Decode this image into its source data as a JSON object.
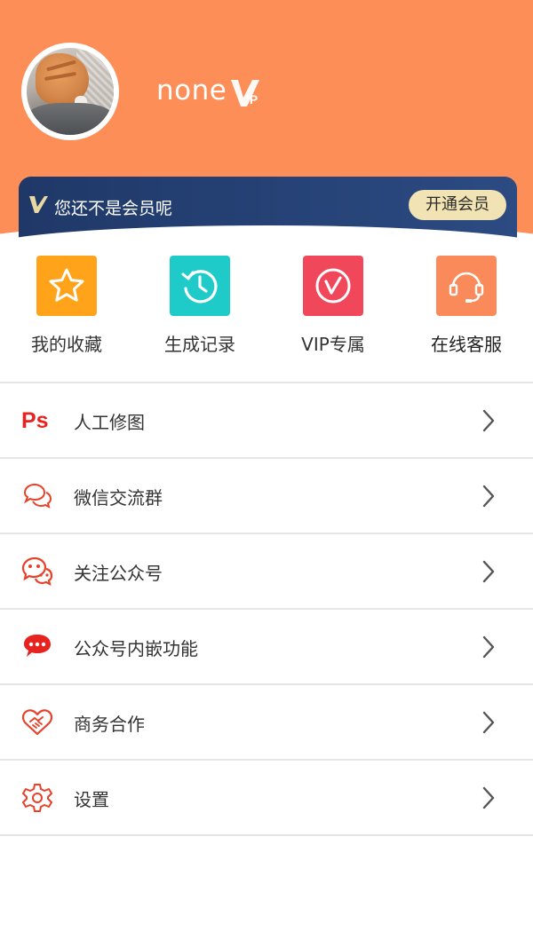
{
  "profile": {
    "username": "none",
    "vip_badge": {
      "text": "VIP",
      "icon": "vip-badge-icon"
    },
    "avatar": {
      "alt": "cat-avatar"
    }
  },
  "membership": {
    "status_text": "您还不是会员呢",
    "button_label": "开通会员",
    "icon": "vip-v-icon"
  },
  "quick_actions": [
    {
      "label": "我的收藏",
      "icon": "star-icon",
      "color": "#ffa31a"
    },
    {
      "label": "生成记录",
      "icon": "history-clock-icon",
      "color": "#1fcbc9"
    },
    {
      "label": "VIP专属",
      "icon": "vip-play-icon",
      "color": "#f1475a"
    },
    {
      "label": "在线客服",
      "icon": "headset-icon",
      "color": "#fb8a5a"
    }
  ],
  "menu": [
    {
      "label": "人工修图",
      "icon": "ps-icon"
    },
    {
      "label": "微信交流群",
      "icon": "chat-bubbles-icon"
    },
    {
      "label": "关注公众号",
      "icon": "wechat-icon"
    },
    {
      "label": "公众号内嵌功能",
      "icon": "message-bubble-icon"
    },
    {
      "label": "商务合作",
      "icon": "handshake-heart-icon"
    },
    {
      "label": "设置",
      "icon": "gear-icon"
    }
  ],
  "colors": {
    "header_bg": "#fe8e57",
    "banner_bg": "#1f3868",
    "vip_button_bg": "#f1e3b4",
    "menu_icon_red": "#e8412a"
  }
}
